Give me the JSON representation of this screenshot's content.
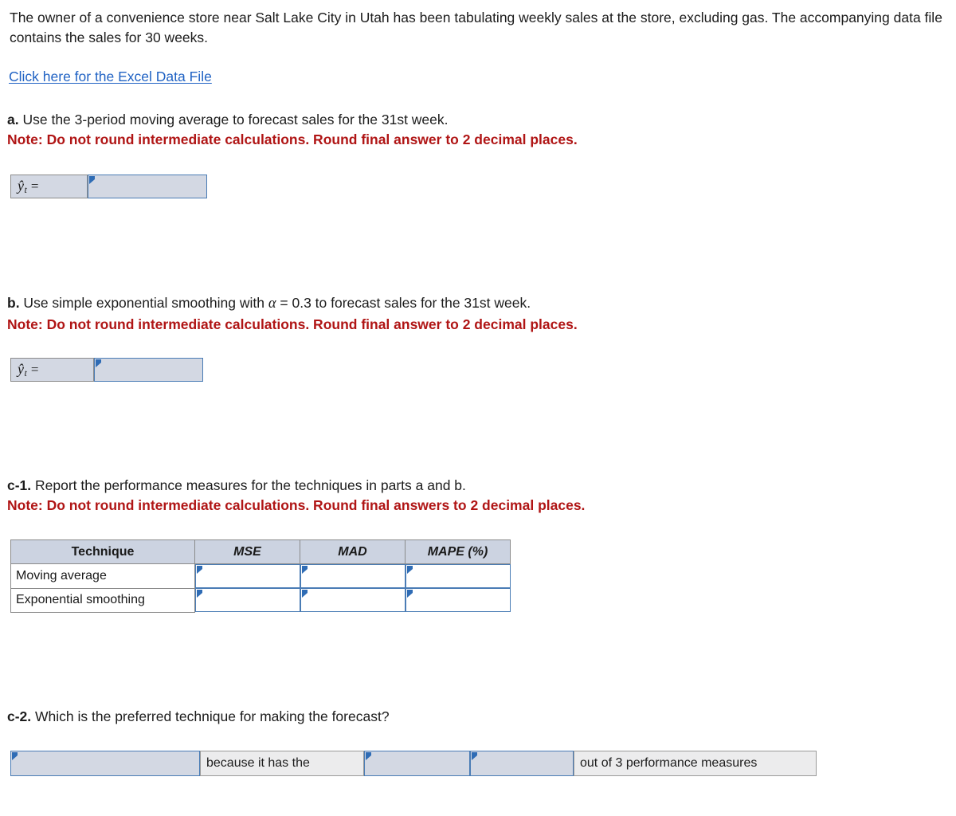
{
  "intro": {
    "paragraph": "The owner of a convenience store near Salt Lake City in Utah has been tabulating weekly sales at the store, excluding gas. The accompanying data file contains the sales for 30 weeks."
  },
  "excel_link": {
    "label": "Click here for the Excel Data File"
  },
  "part_a": {
    "lead": "a.",
    "question": " Use the 3-period moving average to forecast sales for the 31st week.",
    "note": "Note: Do not round intermediate calculations. Round final answer to 2 decimal places.",
    "answer_label_y": "ŷ",
    "answer_label_sub": "t",
    "answer_label_eq": "=",
    "answer_value": ""
  },
  "part_b": {
    "lead": "b.",
    "question_before_alpha": " Use simple exponential smoothing with ",
    "alpha_symbol": "α",
    "question_after_alpha": " = 0.3 to forecast sales for the 31st week.",
    "note": "Note: Do not round intermediate calculations. Round final answer to 2 decimal places.",
    "answer_label_y": "ŷ",
    "answer_label_sub": "t",
    "answer_label_eq": "=",
    "answer_value": ""
  },
  "part_c1": {
    "lead": "c-1.",
    "question": " Report the performance measures for the techniques in parts a and b.",
    "note": "Note: Do not round intermediate calculations. Round final answers to 2 decimal places.",
    "table": {
      "headers": [
        "Technique",
        "MSE",
        "MAD",
        "MAPE (%)"
      ],
      "rows": [
        {
          "technique": "Moving average",
          "mse": "",
          "mad": "",
          "mape": ""
        },
        {
          "technique": "Exponential smoothing",
          "mse": "",
          "mad": "",
          "mape": ""
        }
      ]
    }
  },
  "part_c2": {
    "lead": "c-2.",
    "question": " Which is the preferred technique for making the forecast?",
    "select_1_value": "",
    "middle_text": "because it has the",
    "select_2_value": "",
    "select_3_value": "",
    "trailing_text": "out of 3 performance measures"
  },
  "colors": {
    "link": "#2163c4",
    "note_red": "#b01515",
    "input_border": "#4a7cb5",
    "input_fill": "#d3d8e3",
    "table_header_fill": "#ccd3e1",
    "marker": "#2f6cb5"
  }
}
